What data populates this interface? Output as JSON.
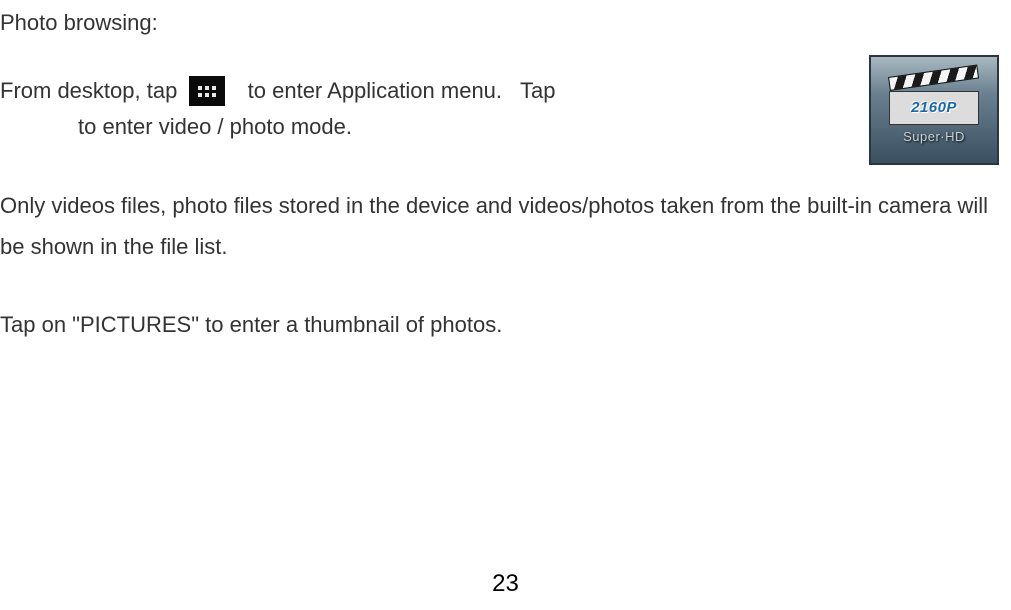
{
  "heading": "Photo browsing:",
  "line1_part1": "From desktop, tap ",
  "line1_part2": "  to enter Application menu.   Tap",
  "line2": "to enter video / photo mode.",
  "paragraph1": "Only videos files, photo files stored in the device and videos/photos taken from the built-in camera will be shown in the file list.",
  "paragraph2": "Tap on \"PICTURES\" to enter a thumbnail of photos.",
  "video_icon": {
    "resolution": "2160P",
    "subtitle": "Super·HD "
  },
  "page_number": "23"
}
